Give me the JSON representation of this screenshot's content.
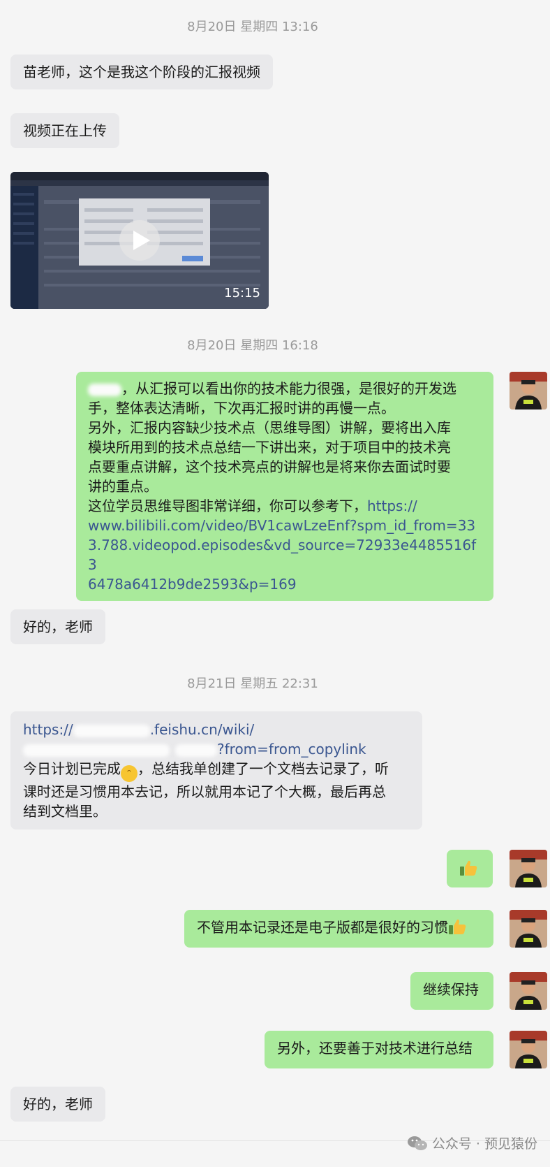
{
  "timestamps": [
    "8月20日 星期四 13:16",
    "8月20日 星期四 16:18",
    "8月21日 星期五 22:31"
  ],
  "messages": {
    "m1": "苗老师，这个是我这个阶段的汇报视频",
    "m2": "视频正在上传",
    "video_duration": "15:15",
    "m4_l1": "，从汇报可以看出你的技术能力很强，是很好的开发选",
    "m4_l2": "手，整体表达清晰，下次再汇报时讲的再慢一点。",
    "m4_l3": "另外，汇报内容缺少技术点（思维导图）讲解，要将出入库",
    "m4_l4": "模块所用到的技术点总结一下讲出来，对于项目中的技术亮",
    "m4_l5": "点要重点讲解，这个技术亮点的讲解也是将来你去面试时要",
    "m4_l6": "讲的重点。",
    "m4_l7": "这位学员思维导图非常详细，你可以参考下，",
    "m4_link1": "https://",
    "m4_link2": "www.bilibili.com/video/BV1cawLzeEnf?spm_id_from=33",
    "m4_link3": "3.788.videopod.episodes&vd_source=72933e4485516f3",
    "m4_link4": "6478a6412b9de2593&p=169",
    "m5": "好的，老师",
    "m6_link1a": "https://",
    "m6_link1b": ".feishu.cn/wiki/",
    "m6_link2": "?from=from_copylink",
    "m6_l3a": "今日计划已完成",
    "m6_l3b": "，总结我单创建了一个文档去记录了，听",
    "m6_l4": "课时还是习惯用本去记，所以就用本记了个大概，最后再总",
    "m6_l5": "结到文档里。",
    "m8": "不管用本记录还是电子版都是很好的习惯",
    "m9": "继续保持",
    "m10": "另外，还要善于对技术进行总结",
    "m11": "好的，老师"
  },
  "watermark": "公众号 · 预见猿份",
  "colors": {
    "incoming": "#e9e9eb",
    "outgoing": "#a9ea9b",
    "link": "#3a5690",
    "background": "#f5f5f5"
  }
}
